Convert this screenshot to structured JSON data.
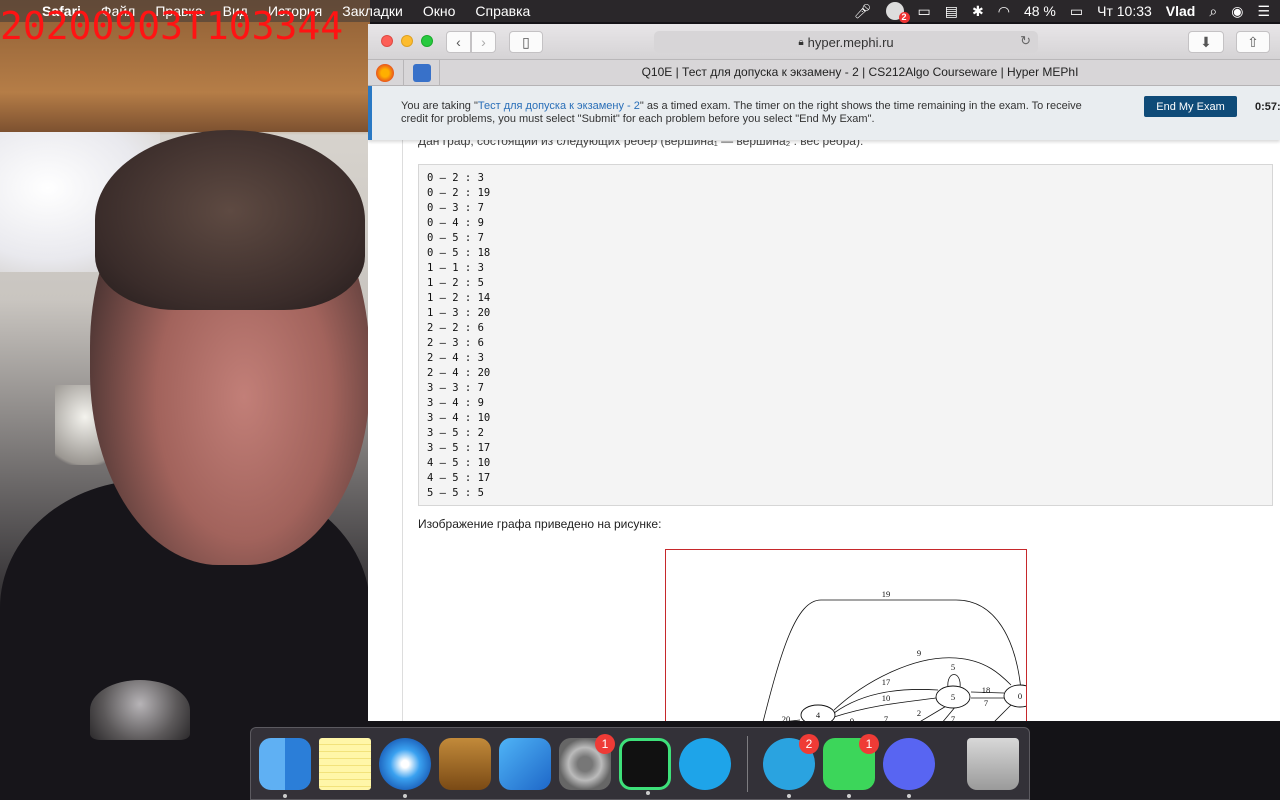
{
  "webcam": {
    "timestamp": "20200903T103344"
  },
  "menubar": {
    "app_name": "Safari",
    "menus": [
      "Файл",
      "Правка",
      "Вид",
      "История",
      "Закладки",
      "Окно",
      "Справка"
    ],
    "notification_count": "2",
    "battery": "48 %",
    "clock": "Чт 10:33",
    "user": "Vlad"
  },
  "browser": {
    "address": "hyper.mephi.ru",
    "tab_title": "Q10E | Тест для допуска к экзамену - 2 | CS212Algo Courseware | Hyper MEPhI"
  },
  "exam_banner": {
    "msg_prefix": "You are taking \"",
    "exam_link": "Тест для допуска к экзамену - 2",
    "msg_suffix": "\" as a timed exam. The timer on the right shows the time remaining in the exam. To receive credit for problems, you must select \"Submit\" for each problem before you select \"End My Exam\".",
    "end_button": "End My Exam",
    "timer": "0:57:"
  },
  "problem": {
    "partial_line": "Дан граф, состоящий из следующих ребер (вершина₁ — вершина₂ : вес ребра):",
    "edges": [
      "0 – 2 : 3",
      "0 – 2 : 19",
      "0 – 3 : 7",
      "0 – 4 : 9",
      "0 – 5 : 7",
      "0 – 5 : 18",
      "1 – 1 : 3",
      "1 – 2 : 5",
      "1 – 2 : 14",
      "1 – 3 : 20",
      "2 – 2 : 6",
      "2 – 3 : 6",
      "2 – 4 : 3",
      "2 – 4 : 20",
      "3 – 3 : 7",
      "3 – 4 : 9",
      "3 – 4 : 10",
      "3 – 5 : 2",
      "3 – 5 : 17",
      "4 – 5 : 10",
      "4 – 5 : 17",
      "5 – 5 : 5"
    ],
    "figure_caption": "Изображение графа приведено на рисунке:",
    "figure_labels": {
      "w19": "19",
      "w9": "9",
      "w5": "5",
      "w17": "17",
      "w10": "10",
      "w18": "18",
      "w7": "7",
      "w2": "2",
      "w20": "20",
      "w7b": "7",
      "w7c": "7",
      "w9b": "9",
      "n4": "4",
      "n5": "5",
      "n0": "0"
    }
  },
  "dock": {
    "telegram_badge": "2",
    "facetime_badge": "1",
    "prefs_badge": "1"
  }
}
